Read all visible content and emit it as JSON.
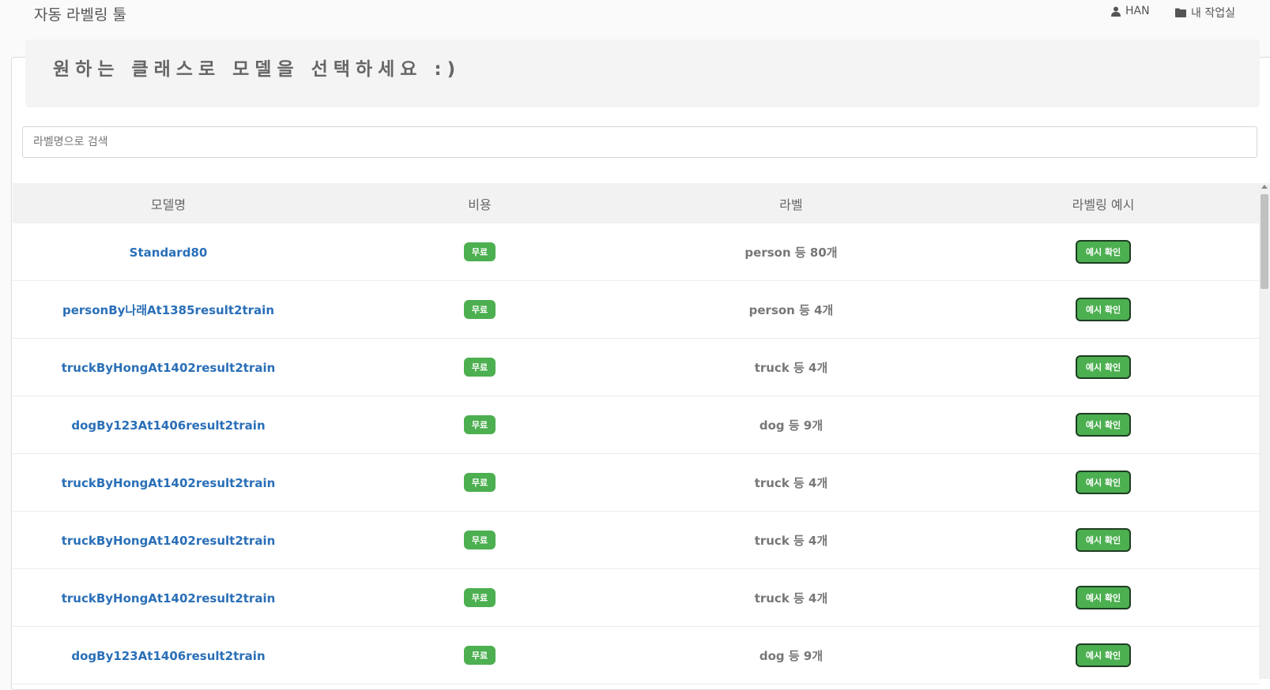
{
  "header": {
    "brand": "자동 라벨링 툴",
    "user_label": "HAN",
    "workspace_label": "내 작업실"
  },
  "jumbotron": {
    "title": "원하는 클래스로 모델을 선택하세요 :)"
  },
  "search": {
    "placeholder": "라벨명으로 검색",
    "value": ""
  },
  "table": {
    "columns": [
      "모델명",
      "비용",
      "라벨",
      "라벨링 예시"
    ],
    "rows": [
      {
        "model": "Standard80",
        "cost": "무료",
        "label": "person 등 80개",
        "example_button": "예시 확인"
      },
      {
        "model": "personBy나래At1385result2train",
        "cost": "무료",
        "label": "person 등 4개",
        "example_button": "예시 확인"
      },
      {
        "model": "truckByHongAt1402result2train",
        "cost": "무료",
        "label": "truck 등 4개",
        "example_button": "예시 확인"
      },
      {
        "model": "dogBy123At1406result2train",
        "cost": "무료",
        "label": "dog 등 9개",
        "example_button": "예시 확인"
      },
      {
        "model": "truckByHongAt1402result2train",
        "cost": "무료",
        "label": "truck 등 4개",
        "example_button": "예시 확인"
      },
      {
        "model": "truckByHongAt1402result2train",
        "cost": "무료",
        "label": "truck 등 4개",
        "example_button": "예시 확인"
      },
      {
        "model": "truckByHongAt1402result2train",
        "cost": "무료",
        "label": "truck 등 4개",
        "example_button": "예시 확인"
      },
      {
        "model": "dogBy123At1406result2train",
        "cost": "무료",
        "label": "dog 등 9개",
        "example_button": "예시 확인"
      }
    ]
  },
  "icons": {
    "user": "user-icon",
    "workspace": "folder-icon"
  },
  "colors": {
    "accent_green": "#4caf50",
    "link_blue": "#2a6fb8"
  }
}
